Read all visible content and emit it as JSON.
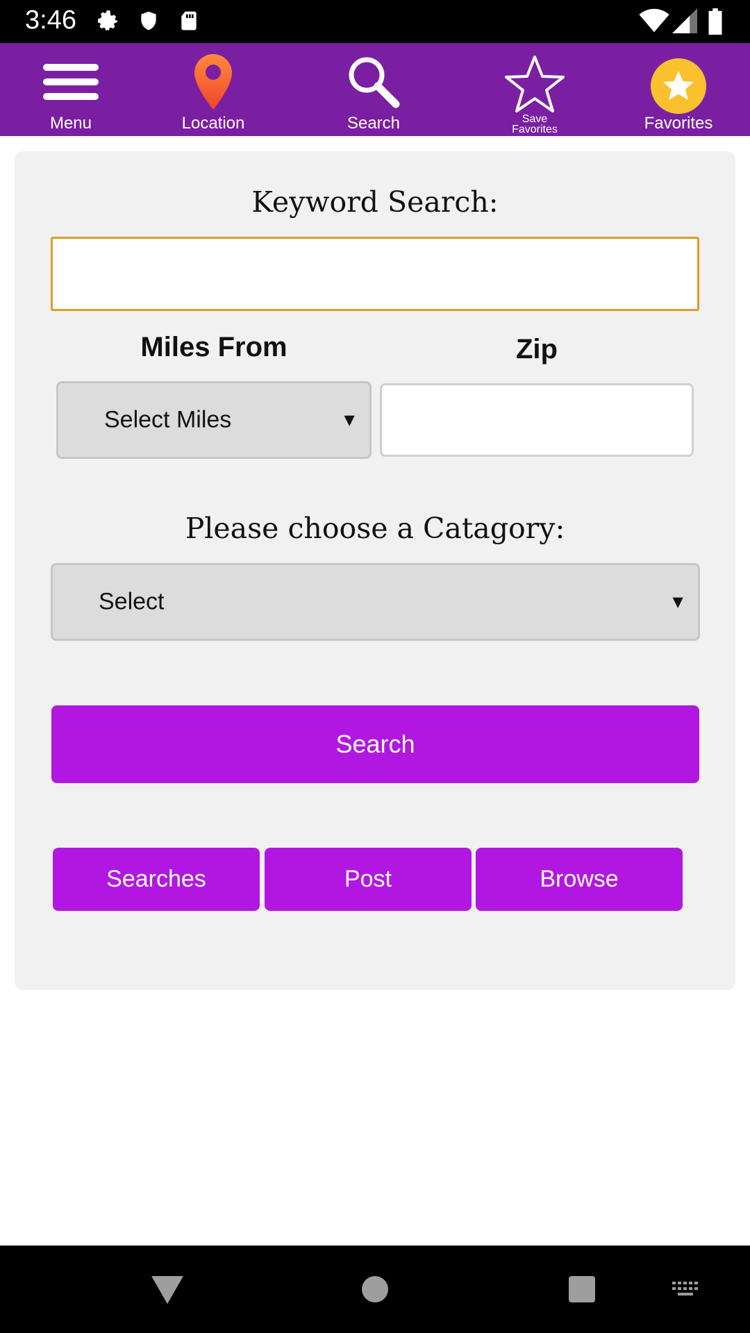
{
  "status_bar": {
    "time": "3:46"
  },
  "top_nav": {
    "items": [
      {
        "label": "Menu",
        "icon": "menu-icon"
      },
      {
        "label": "Location",
        "icon": "location-pin-icon"
      },
      {
        "label": "Search",
        "icon": "search-icon"
      },
      {
        "label_line1": "Save",
        "label_line2": "Favorites",
        "icon": "star-outline-icon"
      },
      {
        "label": "Favorites",
        "icon": "star-filled-icon"
      }
    ]
  },
  "form": {
    "keyword_heading": "Keyword Search:",
    "keyword_value": "",
    "miles_label": "Miles From",
    "miles_selected": "Select Miles",
    "zip_label": "Zip",
    "zip_value": "",
    "category_heading": "Please choose a Catagory:",
    "category_selected": "Select",
    "search_button": "Search"
  },
  "actions": {
    "searches": "Searches",
    "post": "Post",
    "browse": "Browse"
  },
  "colors": {
    "nav_purple": "#7b1fa2",
    "button_purple": "#b217e2",
    "focus_orange": "#d9a025",
    "panel_gray": "#f1f1f1"
  }
}
